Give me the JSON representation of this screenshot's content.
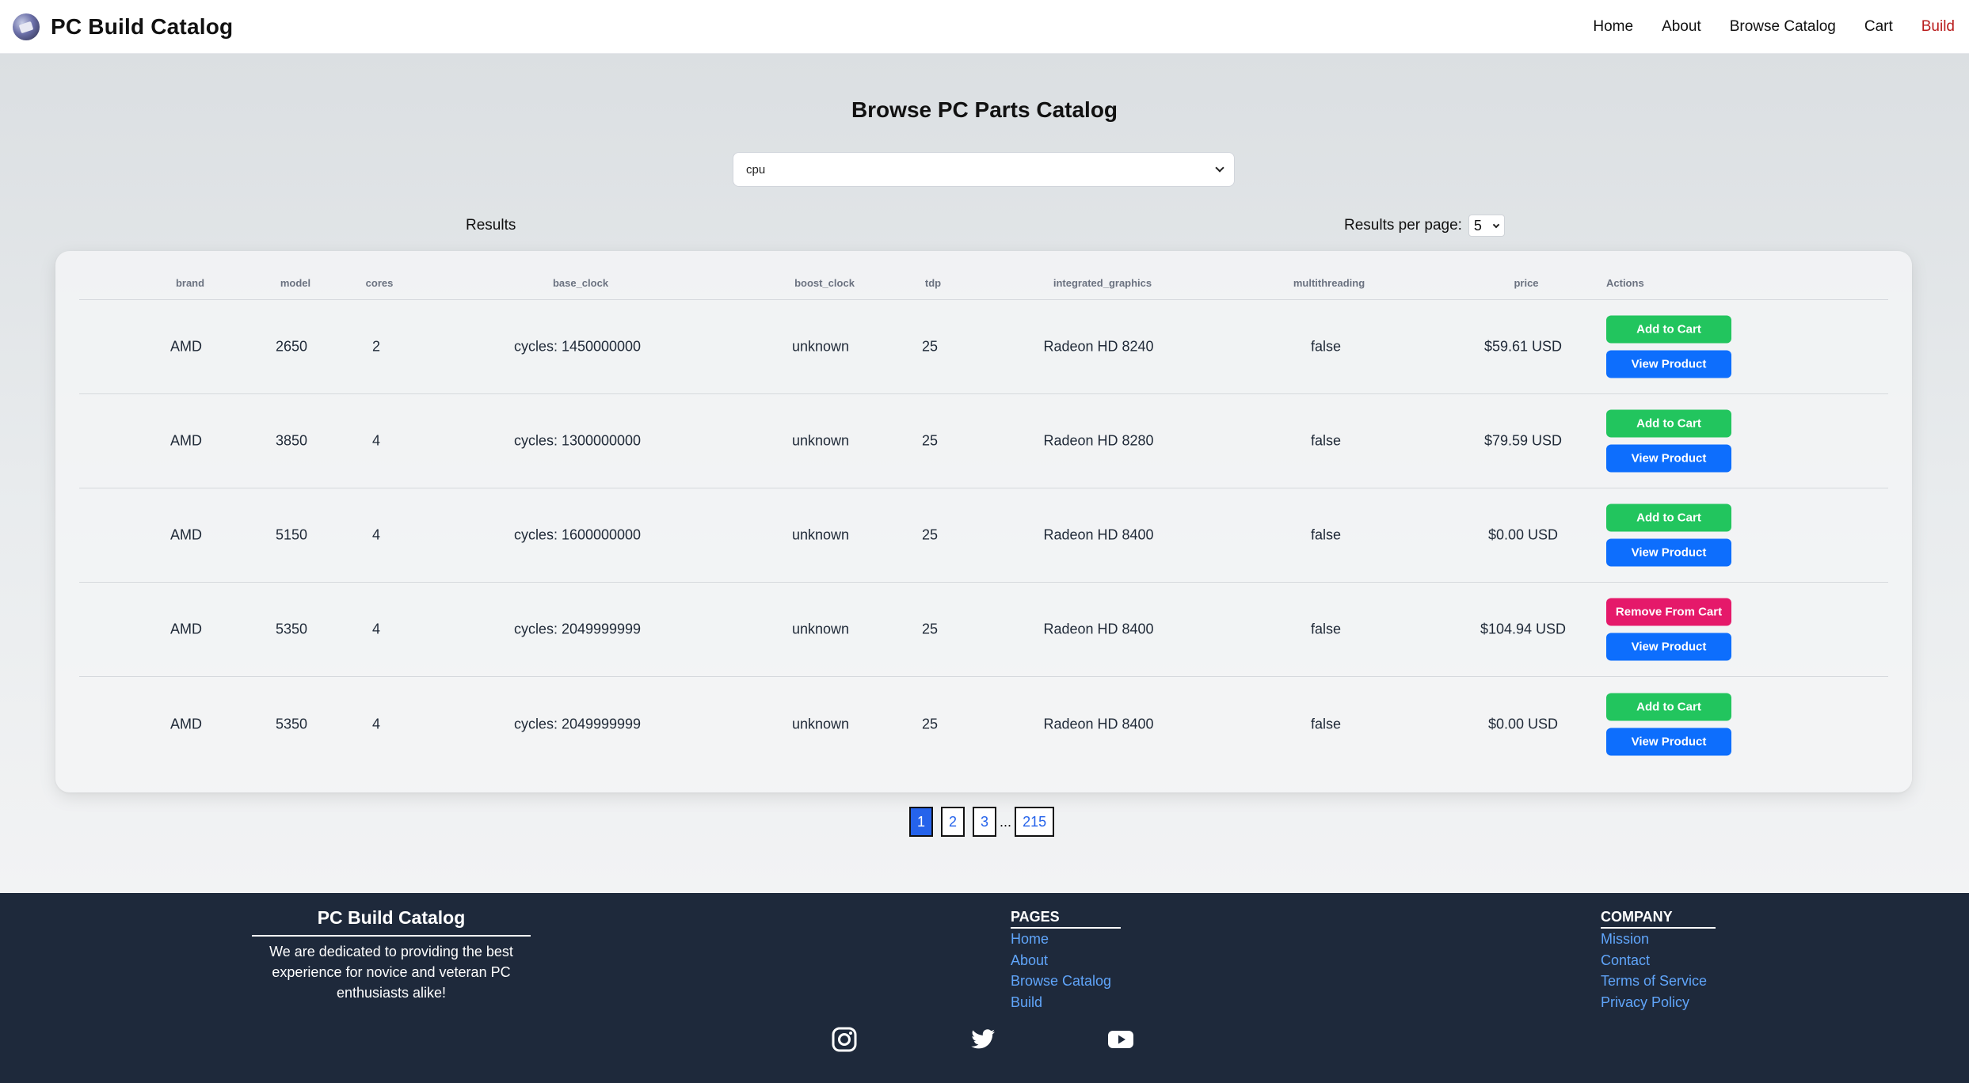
{
  "navbar": {
    "brand": "PC Build Catalog",
    "links": [
      {
        "label": "Home"
      },
      {
        "label": "About"
      },
      {
        "label": "Browse Catalog"
      },
      {
        "label": "Cart"
      },
      {
        "label": "Build"
      }
    ],
    "active_link": "Build"
  },
  "catalog": {
    "title": "Browse PC Parts Catalog",
    "category_selected": "cpu",
    "results_label": "Results",
    "per_page_label": "Results per page:",
    "per_page_value": "5"
  },
  "table": {
    "columns": [
      "brand",
      "model",
      "cores",
      "base_clock",
      "boost_clock",
      "tdp",
      "integrated_graphics",
      "multithreading",
      "price",
      "Actions"
    ],
    "rows": [
      {
        "brand": "AMD",
        "model": "2650",
        "cores": "2",
        "base_clock": "cycles: 1450000000",
        "boost_clock": "unknown",
        "tdp": "25",
        "integrated_graphics": "Radeon HD 8240",
        "multithreading": "false",
        "price": "$59.61 USD",
        "cart_action": "Add to Cart",
        "in_cart": false,
        "view_action": "View Product"
      },
      {
        "brand": "AMD",
        "model": "3850",
        "cores": "4",
        "base_clock": "cycles: 1300000000",
        "boost_clock": "unknown",
        "tdp": "25",
        "integrated_graphics": "Radeon HD 8280",
        "multithreading": "false",
        "price": "$79.59 USD",
        "cart_action": "Add to Cart",
        "in_cart": false,
        "view_action": "View Product"
      },
      {
        "brand": "AMD",
        "model": "5150",
        "cores": "4",
        "base_clock": "cycles: 1600000000",
        "boost_clock": "unknown",
        "tdp": "25",
        "integrated_graphics": "Radeon HD 8400",
        "multithreading": "false",
        "price": "$0.00 USD",
        "cart_action": "Add to Cart",
        "in_cart": false,
        "view_action": "View Product"
      },
      {
        "brand": "AMD",
        "model": "5350",
        "cores": "4",
        "base_clock": "cycles: 2049999999",
        "boost_clock": "unknown",
        "tdp": "25",
        "integrated_graphics": "Radeon HD 8400",
        "multithreading": "false",
        "price": "$104.94 USD",
        "cart_action": "Remove From Cart",
        "in_cart": true,
        "view_action": "View Product"
      },
      {
        "brand": "AMD",
        "model": "5350",
        "cores": "4",
        "base_clock": "cycles: 2049999999",
        "boost_clock": "unknown",
        "tdp": "25",
        "integrated_graphics": "Radeon HD 8400",
        "multithreading": "false",
        "price": "$0.00 USD",
        "cart_action": "Add to Cart",
        "in_cart": false,
        "view_action": "View Product"
      }
    ]
  },
  "pagination": {
    "pages": [
      "1",
      "2",
      "3"
    ],
    "ellipsis": "...",
    "last": "215",
    "current": "1"
  },
  "footer": {
    "about_title": "PC Build Catalog",
    "about_text": "We are dedicated to providing the best experience for novice and veteran PC enthusiasts alike!",
    "pages_title": "PAGES",
    "pages_links": [
      "Home",
      "About",
      "Browse Catalog",
      "Build"
    ],
    "company_title": "COMPANY",
    "company_links": [
      "Mission",
      "Contact",
      "Terms of Service",
      "Privacy Policy"
    ],
    "social_icons": [
      "instagram-icon",
      "twitter-icon",
      "youtube-icon"
    ]
  },
  "colors": {
    "accent_blue": "#0d6efd",
    "add_green": "#22c55e",
    "remove_pink": "#e5196a",
    "active_nav": "#b91c1c",
    "footer_bg": "#1e293b",
    "footer_link": "#60a5fa"
  }
}
